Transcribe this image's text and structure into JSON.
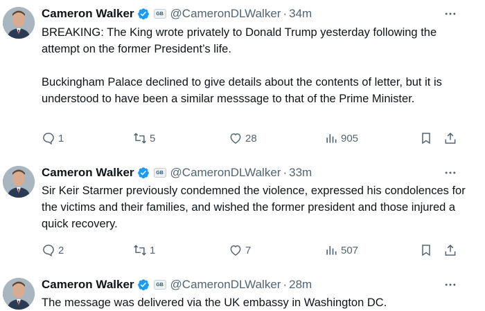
{
  "tweets": [
    {
      "author": "Cameron Walker",
      "handle": "@CameronDLWalker",
      "separator": "·",
      "time": "34m",
      "paragraphs": [
        "BREAKING: The King wrote privately to Donald Trump yesterday following the attempt on the former President’s life.",
        "Buckingham Palace declined to give details about the contents of letter, but it is understood to have been a similar messsage to that of the Prime Minister."
      ],
      "replies": "1",
      "reposts": "5",
      "likes": "28",
      "views": "905"
    },
    {
      "author": "Cameron Walker",
      "handle": "@CameronDLWalker",
      "separator": "·",
      "time": "33m",
      "paragraphs": [
        "Sir Keir Starmer previously condemned the violence, expressed his condolences for the victims and their families, and wished the former president and those injured a quick recovery."
      ],
      "replies": "2",
      "reposts": "1",
      "likes": "7",
      "views": "507"
    },
    {
      "author": "Cameron Walker",
      "handle": "@CameronDLWalker",
      "separator": "·",
      "time": "28m",
      "paragraphs": [
        "The message was delivered via the UK embassy in Washington DC."
      ]
    }
  ],
  "affiliation_badge": "GB",
  "icons": {
    "verified": "verified-badge-icon",
    "more": "more-horizontal-icon",
    "reply": "reply-icon",
    "repost": "repost-icon",
    "like": "heart-icon",
    "views": "views-chart-icon",
    "bookmark": "bookmark-icon",
    "share": "share-icon"
  },
  "colors": {
    "text": "#0f1419",
    "secondary": "#536471",
    "verified": "#1d9bf0"
  }
}
